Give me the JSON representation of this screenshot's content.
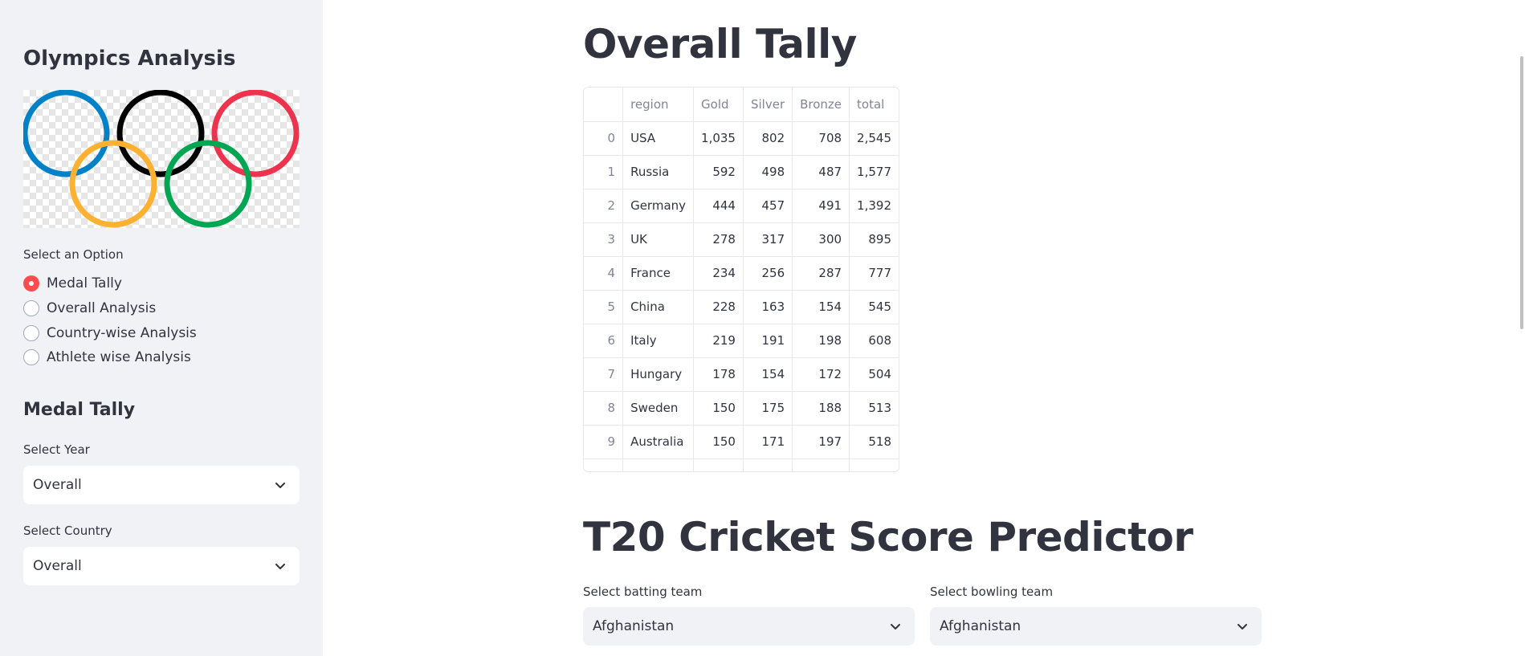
{
  "sidebar": {
    "title": "Olympics Analysis",
    "option_label": "Select an Option",
    "options": [
      "Medal Tally",
      "Overall Analysis",
      "Country-wise Analysis",
      "Athlete wise Analysis"
    ],
    "selected_option": "Medal Tally",
    "section_title": "Medal Tally",
    "year_label": "Select Year",
    "year_value": "Overall",
    "country_label": "Select Country",
    "country_value": "Overall"
  },
  "logo": {
    "ring_colors": [
      "#0081c8",
      "#000000",
      "#ee334e",
      "#fcb131",
      "#00a651"
    ]
  },
  "main": {
    "title": "Overall Tally",
    "table": {
      "columns": [
        "",
        "region",
        "Gold",
        "Silver",
        "Bronze",
        "total"
      ],
      "rows": [
        [
          "0",
          "USA",
          "1,035",
          "802",
          "708",
          "2,545"
        ],
        [
          "1",
          "Russia",
          "592",
          "498",
          "487",
          "1,577"
        ],
        [
          "2",
          "Germany",
          "444",
          "457",
          "491",
          "1,392"
        ],
        [
          "3",
          "UK",
          "278",
          "317",
          "300",
          "895"
        ],
        [
          "4",
          "France",
          "234",
          "256",
          "287",
          "777"
        ],
        [
          "5",
          "China",
          "228",
          "163",
          "154",
          "545"
        ],
        [
          "6",
          "Italy",
          "219",
          "191",
          "198",
          "608"
        ],
        [
          "7",
          "Hungary",
          "178",
          "154",
          "172",
          "504"
        ],
        [
          "8",
          "Sweden",
          "150",
          "175",
          "188",
          "513"
        ],
        [
          "9",
          "Australia",
          "150",
          "171",
          "197",
          "518"
        ]
      ]
    },
    "predictor_title": "T20 Cricket Score Predictor",
    "batting_label": "Select batting team",
    "batting_value": "Afghanistan",
    "bowling_label": "Select bowling team",
    "bowling_value": "Afghanistan"
  },
  "colors": {
    "accent": "#ff4b4b",
    "sidebar_bg": "#f0f2f6",
    "text": "#31333f"
  }
}
